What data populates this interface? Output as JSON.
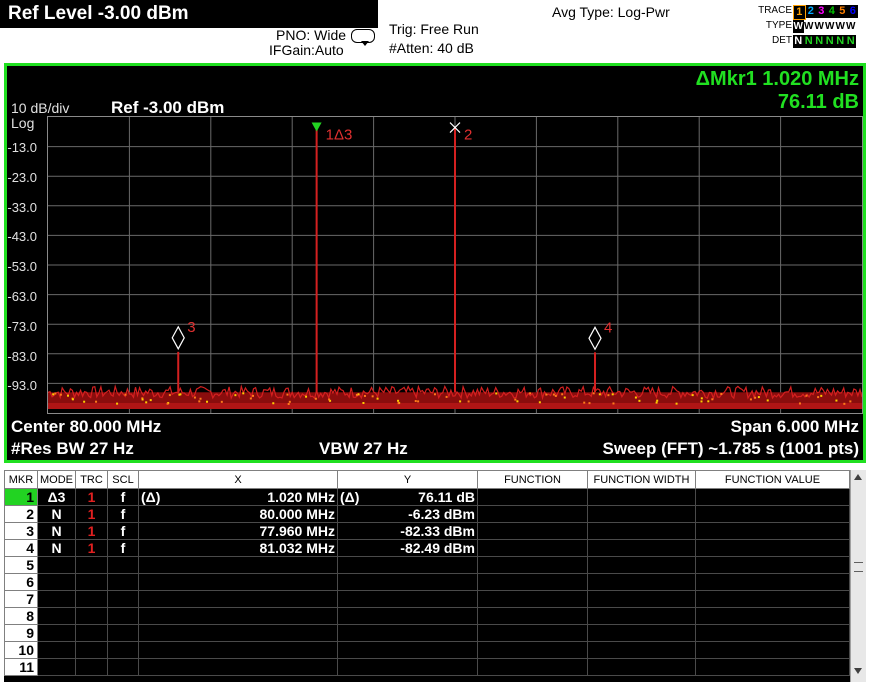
{
  "header": {
    "ref_level": "Ref Level -3.00 dBm",
    "pno": "PNO: Wide",
    "ifgain": "IFGain:Auto",
    "trig": "Trig: Free Run",
    "atten": "#Atten: 40 dB",
    "avg_type": "Avg Type: Log-Pwr",
    "trace_panel": {
      "trace_label": "TRACE",
      "type_label": "TYPE",
      "det_label": "DET",
      "traces": [
        "1",
        "2",
        "3",
        "4",
        "5",
        "6"
      ],
      "trace_colors": [
        "#ffff00",
        "#00aaff",
        "#ff00ff",
        "#00c000",
        "#ff8000",
        "#0000ff"
      ],
      "types": [
        "W",
        "W",
        "W",
        "W",
        "W",
        "W"
      ],
      "dets": [
        "N",
        "N",
        "N",
        "N",
        "N",
        "N"
      ]
    }
  },
  "display": {
    "marker_delta_line1": "ΔMkr1 1.020 MHz",
    "marker_delta_line2": "76.11 dB",
    "scale_div": "10 dB/div",
    "scale_log": "Log",
    "ref_label": "Ref -3.00 dBm",
    "y_labels": [
      "-13.0",
      "-23.0",
      "-33.0",
      "-43.0",
      "-53.0",
      "-63.0",
      "-73.0",
      "-83.0",
      "-93.0"
    ],
    "center": "Center 80.000 MHz",
    "span": "Span 6.000 MHz",
    "res_bw": "#Res BW 27 Hz",
    "vbw": "VBW 27 Hz",
    "sweep": "Sweep (FFT)  ~1.785 s (1001 pts)",
    "colors": {
      "border": "#20e020",
      "trace": "#c00000",
      "marker_text": "#e03030",
      "delta": "#21e021"
    }
  },
  "chart_data": {
    "type": "line",
    "x_label": "",
    "y_label": "",
    "center_mhz": 80.0,
    "span_mhz": 6.0,
    "ylim": [
      -103.0,
      -3.0
    ],
    "noise_floor_dbm": -96.0,
    "peaks": [
      {
        "x_mhz": 77.96,
        "y_dbm": -82.33,
        "label": "3"
      },
      {
        "x_mhz": 78.98,
        "y_dbm": -6.23,
        "label": "1Δ3"
      },
      {
        "x_mhz": 80.0,
        "y_dbm": -6.23,
        "label": "2"
      },
      {
        "x_mhz": 81.032,
        "y_dbm": -82.49,
        "label": "4"
      }
    ]
  },
  "table": {
    "headers": [
      "MKR",
      "MODE",
      "TRC",
      "SCL",
      "X",
      "Y",
      "FUNCTION",
      "FUNCTION WIDTH",
      "FUNCTION VALUE"
    ],
    "rows": [
      {
        "mkr": "1",
        "mode": "Δ3",
        "trc": "1",
        "scl": "f",
        "x_prefix": "(Δ)",
        "x": "1.020 MHz",
        "y_prefix": "(Δ)",
        "y": "76.11 dB",
        "function": "",
        "function_width": "",
        "function_value": ""
      },
      {
        "mkr": "2",
        "mode": "N",
        "trc": "1",
        "scl": "f",
        "x_prefix": "",
        "x": "80.000 MHz",
        "y_prefix": "",
        "y": "-6.23 dBm",
        "function": "",
        "function_width": "",
        "function_value": ""
      },
      {
        "mkr": "3",
        "mode": "N",
        "trc": "1",
        "scl": "f",
        "x_prefix": "",
        "x": "77.960 MHz",
        "y_prefix": "",
        "y": "-82.33 dBm",
        "function": "",
        "function_width": "",
        "function_value": ""
      },
      {
        "mkr": "4",
        "mode": "N",
        "trc": "1",
        "scl": "f",
        "x_prefix": "",
        "x": "81.032 MHz",
        "y_prefix": "",
        "y": "-82.49 dBm",
        "function": "",
        "function_width": "",
        "function_value": ""
      },
      {
        "mkr": "5",
        "mode": "",
        "trc": "",
        "scl": "",
        "x_prefix": "",
        "x": "",
        "y_prefix": "",
        "y": "",
        "function": "",
        "function_width": "",
        "function_value": ""
      },
      {
        "mkr": "6",
        "mode": "",
        "trc": "",
        "scl": "",
        "x_prefix": "",
        "x": "",
        "y_prefix": "",
        "y": "",
        "function": "",
        "function_width": "",
        "function_value": ""
      },
      {
        "mkr": "7",
        "mode": "",
        "trc": "",
        "scl": "",
        "x_prefix": "",
        "x": "",
        "y_prefix": "",
        "y": "",
        "function": "",
        "function_width": "",
        "function_value": ""
      },
      {
        "mkr": "8",
        "mode": "",
        "trc": "",
        "scl": "",
        "x_prefix": "",
        "x": "",
        "y_prefix": "",
        "y": "",
        "function": "",
        "function_width": "",
        "function_value": ""
      },
      {
        "mkr": "9",
        "mode": "",
        "trc": "",
        "scl": "",
        "x_prefix": "",
        "x": "",
        "y_prefix": "",
        "y": "",
        "function": "",
        "function_width": "",
        "function_value": ""
      },
      {
        "mkr": "10",
        "mode": "",
        "trc": "",
        "scl": "",
        "x_prefix": "",
        "x": "",
        "y_prefix": "",
        "y": "",
        "function": "",
        "function_width": "",
        "function_value": ""
      },
      {
        "mkr": "11",
        "mode": "",
        "trc": "",
        "scl": "",
        "x_prefix": "",
        "x": "",
        "y_prefix": "",
        "y": "",
        "function": "",
        "function_width": "",
        "function_value": ""
      }
    ]
  }
}
